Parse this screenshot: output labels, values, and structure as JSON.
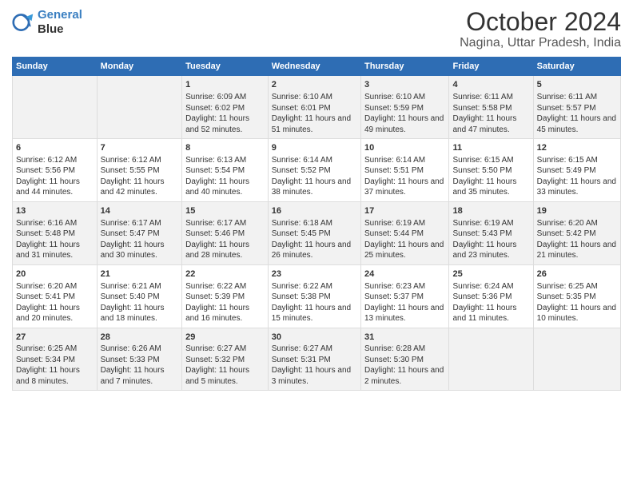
{
  "header": {
    "logo_line1": "General",
    "logo_line2": "Blue",
    "title": "October 2024",
    "subtitle": "Nagina, Uttar Pradesh, India"
  },
  "days_of_week": [
    "Sunday",
    "Monday",
    "Tuesday",
    "Wednesday",
    "Thursday",
    "Friday",
    "Saturday"
  ],
  "weeks": [
    [
      {
        "day": "",
        "sunrise": "",
        "sunset": "",
        "daylight": ""
      },
      {
        "day": "",
        "sunrise": "",
        "sunset": "",
        "daylight": ""
      },
      {
        "day": "1",
        "sunrise": "Sunrise: 6:09 AM",
        "sunset": "Sunset: 6:02 PM",
        "daylight": "Daylight: 11 hours and 52 minutes."
      },
      {
        "day": "2",
        "sunrise": "Sunrise: 6:10 AM",
        "sunset": "Sunset: 6:01 PM",
        "daylight": "Daylight: 11 hours and 51 minutes."
      },
      {
        "day": "3",
        "sunrise": "Sunrise: 6:10 AM",
        "sunset": "Sunset: 5:59 PM",
        "daylight": "Daylight: 11 hours and 49 minutes."
      },
      {
        "day": "4",
        "sunrise": "Sunrise: 6:11 AM",
        "sunset": "Sunset: 5:58 PM",
        "daylight": "Daylight: 11 hours and 47 minutes."
      },
      {
        "day": "5",
        "sunrise": "Sunrise: 6:11 AM",
        "sunset": "Sunset: 5:57 PM",
        "daylight": "Daylight: 11 hours and 45 minutes."
      }
    ],
    [
      {
        "day": "6",
        "sunrise": "Sunrise: 6:12 AM",
        "sunset": "Sunset: 5:56 PM",
        "daylight": "Daylight: 11 hours and 44 minutes."
      },
      {
        "day": "7",
        "sunrise": "Sunrise: 6:12 AM",
        "sunset": "Sunset: 5:55 PM",
        "daylight": "Daylight: 11 hours and 42 minutes."
      },
      {
        "day": "8",
        "sunrise": "Sunrise: 6:13 AM",
        "sunset": "Sunset: 5:54 PM",
        "daylight": "Daylight: 11 hours and 40 minutes."
      },
      {
        "day": "9",
        "sunrise": "Sunrise: 6:14 AM",
        "sunset": "Sunset: 5:52 PM",
        "daylight": "Daylight: 11 hours and 38 minutes."
      },
      {
        "day": "10",
        "sunrise": "Sunrise: 6:14 AM",
        "sunset": "Sunset: 5:51 PM",
        "daylight": "Daylight: 11 hours and 37 minutes."
      },
      {
        "day": "11",
        "sunrise": "Sunrise: 6:15 AM",
        "sunset": "Sunset: 5:50 PM",
        "daylight": "Daylight: 11 hours and 35 minutes."
      },
      {
        "day": "12",
        "sunrise": "Sunrise: 6:15 AM",
        "sunset": "Sunset: 5:49 PM",
        "daylight": "Daylight: 11 hours and 33 minutes."
      }
    ],
    [
      {
        "day": "13",
        "sunrise": "Sunrise: 6:16 AM",
        "sunset": "Sunset: 5:48 PM",
        "daylight": "Daylight: 11 hours and 31 minutes."
      },
      {
        "day": "14",
        "sunrise": "Sunrise: 6:17 AM",
        "sunset": "Sunset: 5:47 PM",
        "daylight": "Daylight: 11 hours and 30 minutes."
      },
      {
        "day": "15",
        "sunrise": "Sunrise: 6:17 AM",
        "sunset": "Sunset: 5:46 PM",
        "daylight": "Daylight: 11 hours and 28 minutes."
      },
      {
        "day": "16",
        "sunrise": "Sunrise: 6:18 AM",
        "sunset": "Sunset: 5:45 PM",
        "daylight": "Daylight: 11 hours and 26 minutes."
      },
      {
        "day": "17",
        "sunrise": "Sunrise: 6:19 AM",
        "sunset": "Sunset: 5:44 PM",
        "daylight": "Daylight: 11 hours and 25 minutes."
      },
      {
        "day": "18",
        "sunrise": "Sunrise: 6:19 AM",
        "sunset": "Sunset: 5:43 PM",
        "daylight": "Daylight: 11 hours and 23 minutes."
      },
      {
        "day": "19",
        "sunrise": "Sunrise: 6:20 AM",
        "sunset": "Sunset: 5:42 PM",
        "daylight": "Daylight: 11 hours and 21 minutes."
      }
    ],
    [
      {
        "day": "20",
        "sunrise": "Sunrise: 6:20 AM",
        "sunset": "Sunset: 5:41 PM",
        "daylight": "Daylight: 11 hours and 20 minutes."
      },
      {
        "day": "21",
        "sunrise": "Sunrise: 6:21 AM",
        "sunset": "Sunset: 5:40 PM",
        "daylight": "Daylight: 11 hours and 18 minutes."
      },
      {
        "day": "22",
        "sunrise": "Sunrise: 6:22 AM",
        "sunset": "Sunset: 5:39 PM",
        "daylight": "Daylight: 11 hours and 16 minutes."
      },
      {
        "day": "23",
        "sunrise": "Sunrise: 6:22 AM",
        "sunset": "Sunset: 5:38 PM",
        "daylight": "Daylight: 11 hours and 15 minutes."
      },
      {
        "day": "24",
        "sunrise": "Sunrise: 6:23 AM",
        "sunset": "Sunset: 5:37 PM",
        "daylight": "Daylight: 11 hours and 13 minutes."
      },
      {
        "day": "25",
        "sunrise": "Sunrise: 6:24 AM",
        "sunset": "Sunset: 5:36 PM",
        "daylight": "Daylight: 11 hours and 11 minutes."
      },
      {
        "day": "26",
        "sunrise": "Sunrise: 6:25 AM",
        "sunset": "Sunset: 5:35 PM",
        "daylight": "Daylight: 11 hours and 10 minutes."
      }
    ],
    [
      {
        "day": "27",
        "sunrise": "Sunrise: 6:25 AM",
        "sunset": "Sunset: 5:34 PM",
        "daylight": "Daylight: 11 hours and 8 minutes."
      },
      {
        "day": "28",
        "sunrise": "Sunrise: 6:26 AM",
        "sunset": "Sunset: 5:33 PM",
        "daylight": "Daylight: 11 hours and 7 minutes."
      },
      {
        "day": "29",
        "sunrise": "Sunrise: 6:27 AM",
        "sunset": "Sunset: 5:32 PM",
        "daylight": "Daylight: 11 hours and 5 minutes."
      },
      {
        "day": "30",
        "sunrise": "Sunrise: 6:27 AM",
        "sunset": "Sunset: 5:31 PM",
        "daylight": "Daylight: 11 hours and 3 minutes."
      },
      {
        "day": "31",
        "sunrise": "Sunrise: 6:28 AM",
        "sunset": "Sunset: 5:30 PM",
        "daylight": "Daylight: 11 hours and 2 minutes."
      },
      {
        "day": "",
        "sunrise": "",
        "sunset": "",
        "daylight": ""
      },
      {
        "day": "",
        "sunrise": "",
        "sunset": "",
        "daylight": ""
      }
    ]
  ]
}
